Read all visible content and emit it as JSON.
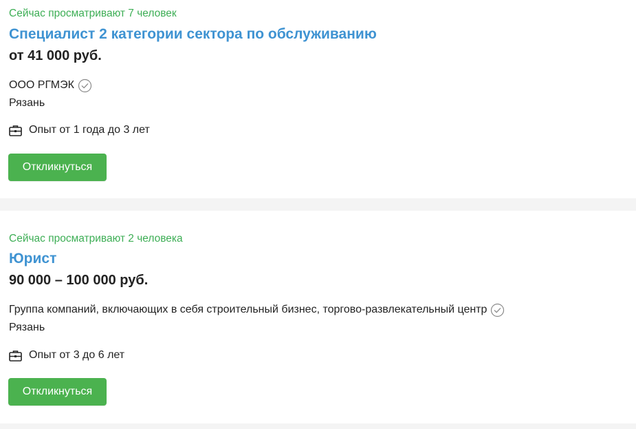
{
  "vacancies": [
    {
      "viewers": "Сейчас просматривают 7 человек",
      "title": "Специалист 2 категории сектора по обслуживанию",
      "salary": "от 41 000 руб.",
      "company": "ООО РГМЭК",
      "company_verified_icon": "check-circle-icon",
      "city": "Рязань",
      "experience_icon": "briefcase-icon",
      "experience": "Опыт от 1 года до 3 лет",
      "apply_label": "Откликнуться"
    },
    {
      "viewers": "Сейчас просматривают 2 человека",
      "title": "Юрист",
      "salary": "90 000 – 100 000 руб.",
      "company": "Группа компаний, включающих в себя строительный бизнес, торгово-развлекательный центр",
      "company_verified_icon": "check-circle-icon",
      "city": "Рязань",
      "experience_icon": "briefcase-icon",
      "experience": "Опыт от 3 до 6 лет",
      "apply_label": "Откликнуться"
    }
  ],
  "colors": {
    "viewers_text": "#3dae55",
    "title_link": "#3f93d2",
    "body_text": "#232323",
    "apply_button": "#4bb24f",
    "page_background": "#f4f4f4"
  }
}
